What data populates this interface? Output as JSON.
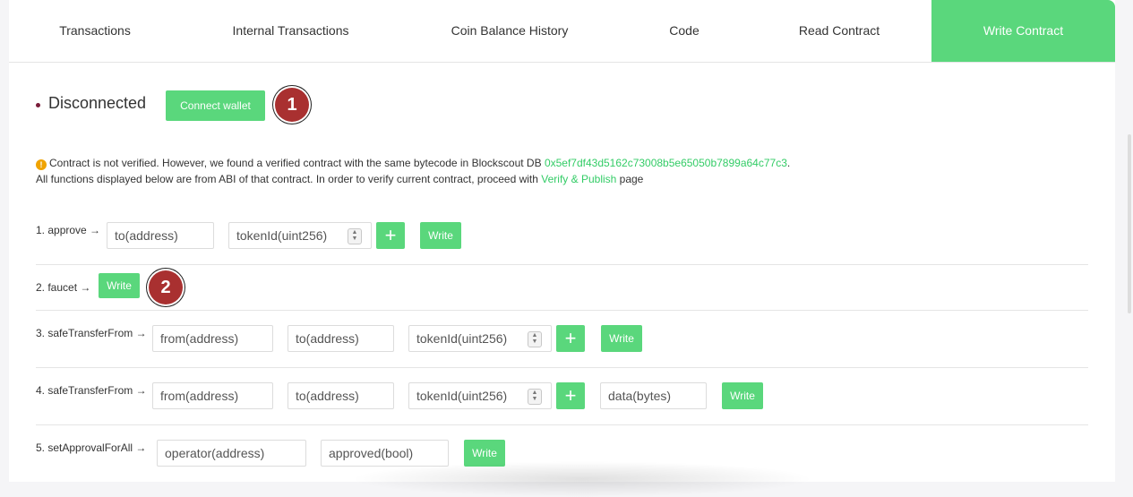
{
  "tabs": [
    {
      "label": "Transactions"
    },
    {
      "label": "Internal Transactions"
    },
    {
      "label": "Coin Balance History"
    },
    {
      "label": "Code"
    },
    {
      "label": "Read Contract"
    },
    {
      "label": "Write Contract",
      "active": true
    }
  ],
  "wallet": {
    "status": "Disconnected",
    "connect_label": "Connect wallet"
  },
  "badges": [
    "1",
    "2"
  ],
  "notice": {
    "icon": "info-icon",
    "line1_pre": "Contract is not verified. However, we found a verified contract with the same bytecode in Blockscout DB ",
    "address": "0x5ef7df43d5162c73008b5e65050b7899a64c77c3",
    "line1_post": ".",
    "line2_pre": "All functions displayed below are from ABI of that contract. In order to verify current contract, proceed with ",
    "verify_link": "Verify & Publish",
    "line2_post": " page"
  },
  "functions": [
    {
      "label": "1. approve →",
      "inputs": [
        "to(address)",
        "tokenId(uint256)"
      ],
      "write": "Write"
    },
    {
      "label": "2. faucet →",
      "inputs": [],
      "write": "Write"
    },
    {
      "label": "3. safeTransferFrom →",
      "inputs": [
        "from(address)",
        "to(address)",
        "tokenId(uint256)"
      ],
      "write": "Write"
    },
    {
      "label": "4. safeTransferFrom →",
      "inputs": [
        "from(address)",
        "to(address)",
        "tokenId(uint256)",
        "data(bytes)"
      ],
      "write": "Write"
    },
    {
      "label": "5. setApprovalForAll →",
      "inputs": [
        "operator(address)",
        "approved(bool)"
      ],
      "write": "Write"
    }
  ],
  "plus_label": "+",
  "colors": {
    "accent": "#5ad77c",
    "badge": "#a93030",
    "link": "#33cc66"
  }
}
